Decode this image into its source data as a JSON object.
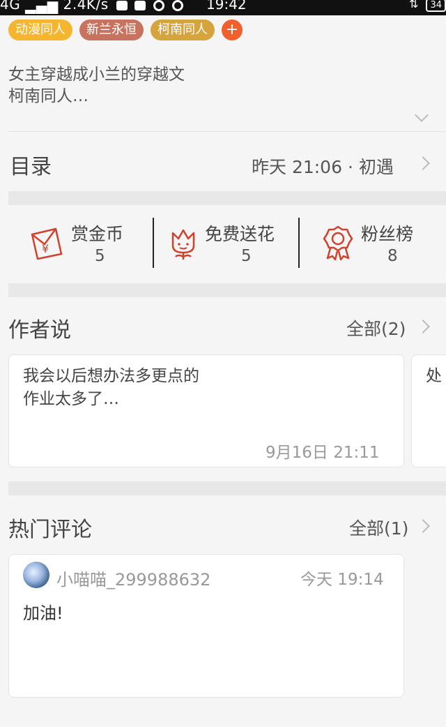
{
  "status_bar": {
    "network": "4G",
    "speed": "2.4K/s",
    "time": "19:42",
    "battery": "34"
  },
  "tags": [
    {
      "label": "动漫同人",
      "color": "#f5b52e"
    },
    {
      "label": "新兰永恒",
      "color": "#c8735f"
    },
    {
      "label": "柯南同人",
      "color": "#d6a43d"
    }
  ],
  "tag_add": "+",
  "description": {
    "line1": "女主穿越成小兰的穿越文",
    "line2": "柯南同人…"
  },
  "catalog": {
    "title": "目录",
    "update_time": "昨天 21:06",
    "separator": "·",
    "latest_chapter": "初遇"
  },
  "stats": [
    {
      "label": "赏金币",
      "value": "5",
      "icon": "red-envelope-icon"
    },
    {
      "label": "免费送花",
      "value": "5",
      "icon": "flower-icon"
    },
    {
      "label": "粉丝榜",
      "value": "8",
      "icon": "medal-icon"
    }
  ],
  "author_says": {
    "title": "作者说",
    "all_label": "全部(2)",
    "card": {
      "line1": "我会以后想办法多更点的",
      "line2": "作业太多了…",
      "date": "9月16日  21:11"
    },
    "next_card_peek": "处"
  },
  "hot_comments": {
    "title": "热门评论",
    "all_label": "全部(1)",
    "comment": {
      "username": "小喵喵_299988632",
      "time": "今天 19:14",
      "text": "加油!"
    }
  },
  "colors": {
    "accent_red": "#d2402a",
    "tag_add": "#f05f2c"
  }
}
